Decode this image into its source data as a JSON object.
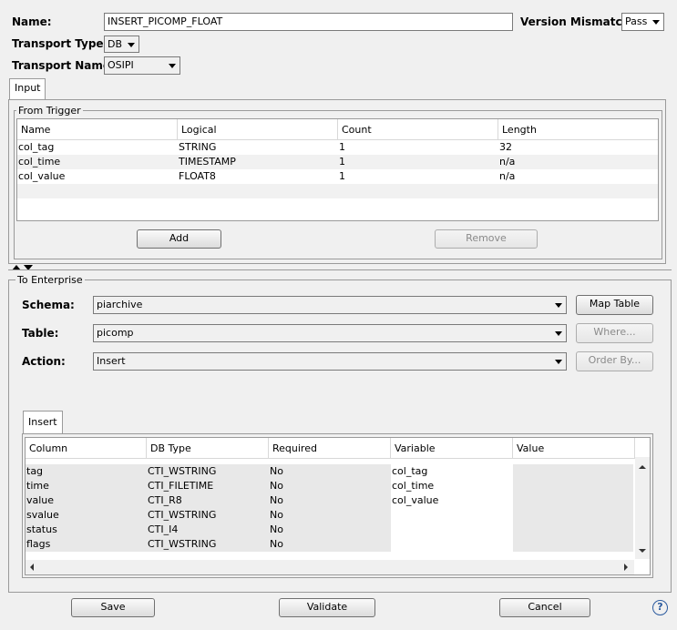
{
  "header": {
    "name_label": "Name:",
    "name_value": "INSERT_PICOMP_FLOAT",
    "version_mismatch_label": "Version Mismatch:",
    "version_mismatch_value": "Pass",
    "transport_type_label": "Transport Type:",
    "transport_type_value": "DB",
    "transport_name_label": "Transport Name:",
    "transport_name_value": "OSIPI"
  },
  "input_tab": {
    "tab_label": "Input",
    "group_title": "From Trigger",
    "columns": [
      "Name",
      "Logical",
      "Count",
      "Length"
    ],
    "rows": [
      [
        "col_tag",
        "STRING",
        "1",
        "32"
      ],
      [
        "col_time",
        "TIMESTAMP",
        "1",
        "n/a"
      ],
      [
        "col_value",
        "FLOAT8",
        "1",
        "n/a"
      ]
    ],
    "add_label": "Add",
    "remove_label": "Remove"
  },
  "enterprise": {
    "group_title": "To Enterprise",
    "schema_label": "Schema:",
    "schema_value": "piarchive",
    "table_label": "Table:",
    "table_value": "picomp",
    "action_label": "Action:",
    "action_value": "Insert",
    "map_table_label": "Map Table",
    "where_label": "Where...",
    "order_by_label": "Order By...",
    "insert_tab_label": "Insert",
    "columns": [
      "Column",
      "DB Type",
      "Required",
      "Variable",
      "Value"
    ],
    "rows": [
      [
        "tag",
        "CTI_WSTRING",
        "No",
        "col_tag",
        ""
      ],
      [
        "time",
        "CTI_FILETIME",
        "No",
        "col_time",
        ""
      ],
      [
        "value",
        "CTI_R8",
        "No",
        "col_value",
        ""
      ],
      [
        "svalue",
        "CTI_WSTRING",
        "No",
        "",
        ""
      ],
      [
        "status",
        "CTI_I4",
        "No",
        "",
        ""
      ],
      [
        "flags",
        "CTI_WSTRING",
        "No",
        "",
        ""
      ]
    ]
  },
  "footer": {
    "save_label": "Save",
    "validate_label": "Validate",
    "cancel_label": "Cancel",
    "help_icon": "?"
  }
}
